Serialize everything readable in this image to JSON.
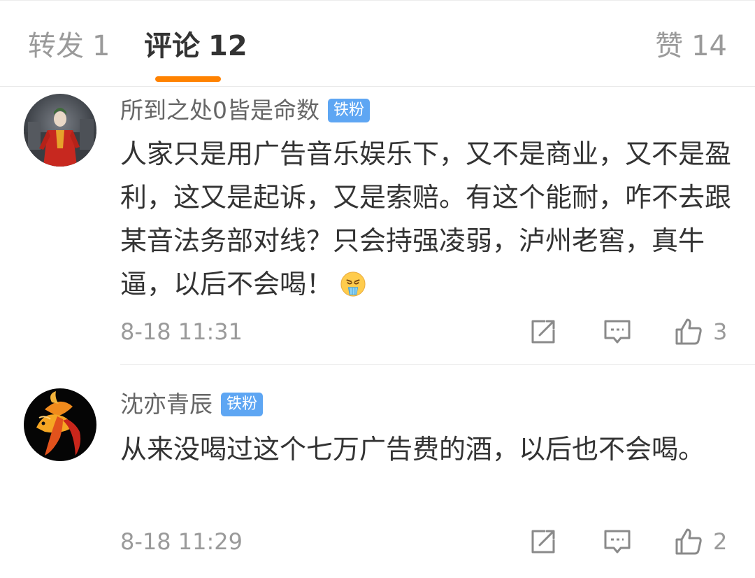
{
  "tabs": {
    "repost": {
      "label": "转发",
      "count": "1"
    },
    "comments": {
      "label": "评论",
      "count": "12"
    },
    "likes": {
      "label": "赞",
      "count": "14"
    },
    "active_color": "#ff8200"
  },
  "comments": [
    {
      "username": "所到之处0皆是命数",
      "badge": "铁粉",
      "text": "人家只是用广告音乐娱乐下，又不是商业，又不是盈利，这又是起诉，又是索赔。有这个能耐，咋不去跟某音法务部对线？只会持强凌弱，泸州老窖，真牛逼，以后不会喝！",
      "emoji": "vomit-emoji",
      "time": "8-18 11:31",
      "likes": "3",
      "avatar": "joker-avatar"
    },
    {
      "username": "沈亦青辰",
      "badge": "铁粉",
      "text": "从来没喝过这个七万广告费的酒，以后也不会喝。",
      "time": "8-18 11:29",
      "likes": "2",
      "avatar": "betta-fish-avatar"
    }
  ],
  "colors": {
    "badge": "#5ea6f3",
    "muted_text": "#9a9a9a",
    "body_text": "#333333"
  }
}
